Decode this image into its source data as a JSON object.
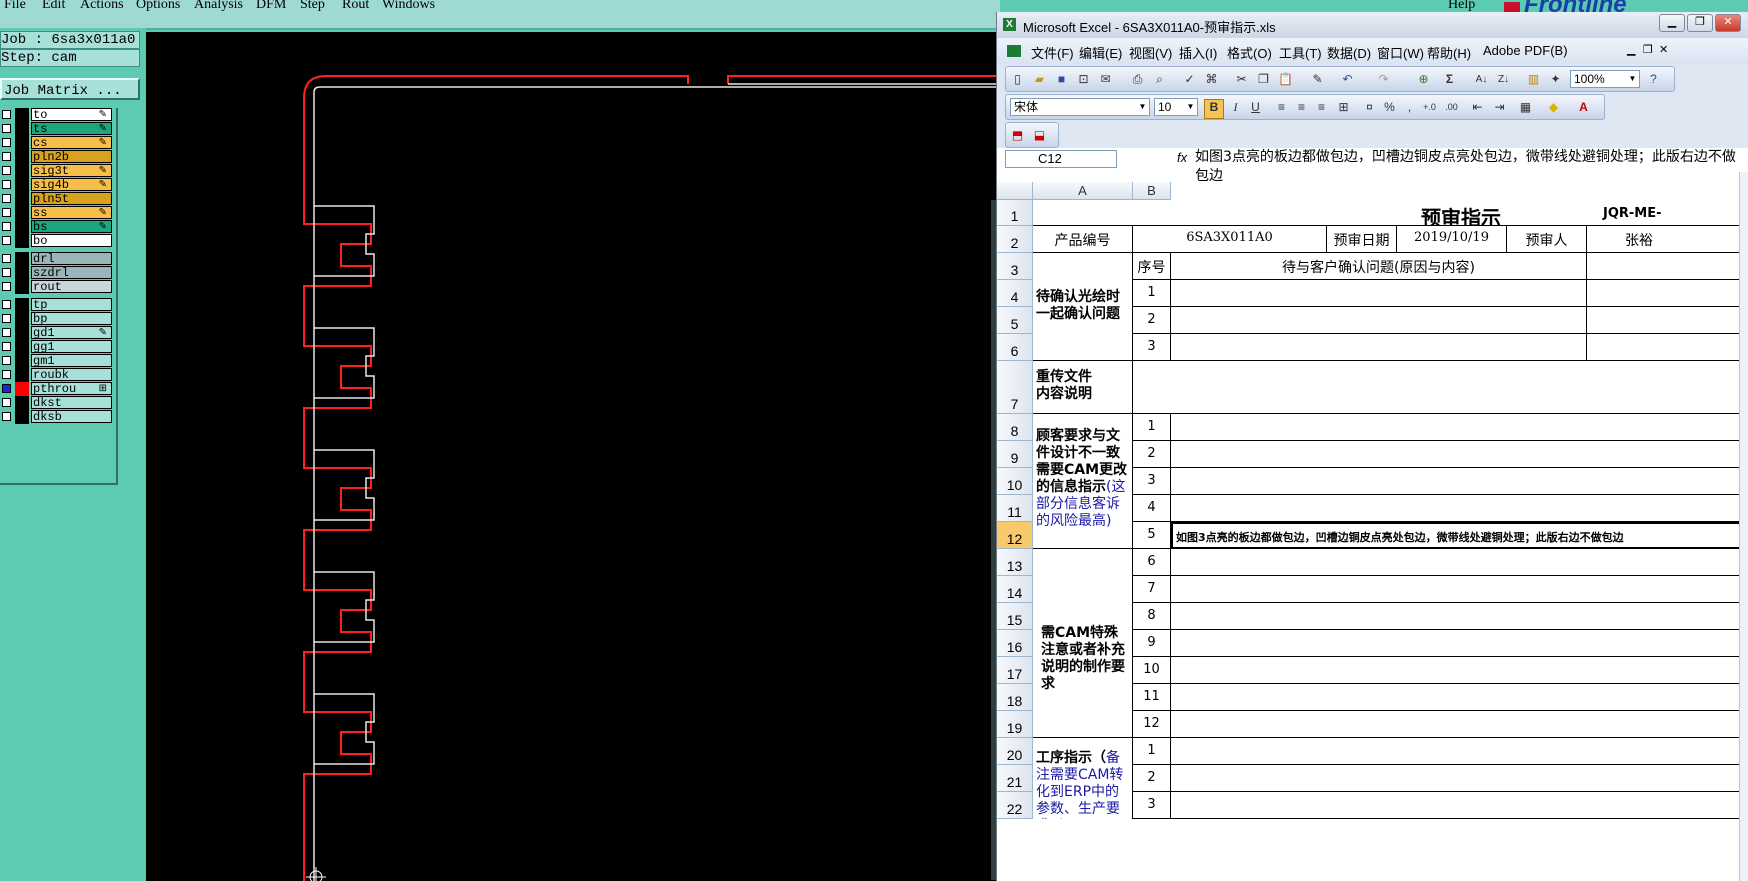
{
  "cam": {
    "menu": [
      "File",
      "Edit",
      "Actions",
      "Options",
      "Analysis",
      "DFM",
      "Step",
      "Rout",
      "Windows"
    ],
    "help": "Help",
    "logo_text": "Frontline",
    "job_line": "Job : 6sa3x011a0",
    "step_line": "Step: cam",
    "job_matrix": "Job Matrix ...",
    "layers": [
      {
        "name": "to",
        "color": "#ffffff",
        "edit": true
      },
      {
        "name": "ts",
        "color": "#1ca77f",
        "edit": true
      },
      {
        "name": "cs",
        "color": "#f7bf4a",
        "edit": true
      },
      {
        "name": "pln2b",
        "color": "#d9a21e",
        "edit": false
      },
      {
        "name": "sig3t",
        "color": "#f7bf4a",
        "edit": true
      },
      {
        "name": "sig4b",
        "color": "#f7bf4a",
        "edit": true
      },
      {
        "name": "pln5t",
        "color": "#d9a21e",
        "edit": false
      },
      {
        "name": "ss",
        "color": "#f7bf4a",
        "edit": true
      },
      {
        "name": "bs",
        "color": "#1ca77f",
        "edit": true
      },
      {
        "name": "bo",
        "color": "#ffffff",
        "edit": false
      },
      {
        "name": "drl",
        "color": "#9ab6ba",
        "edit": false
      },
      {
        "name": "szdrl",
        "color": "#9ab6ba",
        "edit": false
      },
      {
        "name": "rout",
        "color": "#c8d8da",
        "edit": false
      },
      {
        "name": "tp",
        "color": "#a6e0d8",
        "edit": false
      },
      {
        "name": "bp",
        "color": "#a6e0d8",
        "edit": false
      },
      {
        "name": "gd1",
        "color": "#a6e0d8",
        "edit": true
      },
      {
        "name": "gg1",
        "color": "#a6e0d8",
        "edit": false
      },
      {
        "name": "gm1",
        "color": "#a6e0d8",
        "edit": false
      },
      {
        "name": "roubk",
        "color": "#a6e0d8",
        "edit": false
      },
      {
        "name": "pthrou",
        "color": "#a6e0d8",
        "edit": false,
        "active": true
      },
      {
        "name": "dkst",
        "color": "#a6e0d8",
        "edit": false
      },
      {
        "name": "dksb",
        "color": "#a6e0d8",
        "edit": false
      }
    ]
  },
  "excel": {
    "title": "Microsoft Excel - 6SA3X011A0-预审指示.xls",
    "menu": [
      "文件(F)",
      "编辑(E)",
      "视图(V)",
      "插入(I)",
      "格式(O)",
      "工具(T)",
      "数据(D)",
      "窗口(W)",
      "帮助(H)",
      "Adobe PDF(B)"
    ],
    "zoom": "100%",
    "font": "宋体",
    "font_size": "10",
    "namebox": "C12",
    "fx": "fx",
    "formula": "如图3点亮的板边都做包边，凹槽边铜皮点亮处包边，微带线处避铜处理；此版右边不做包边",
    "cols": [
      "A",
      "B"
    ],
    "rows": [
      "1",
      "2",
      "3",
      "4",
      "5",
      "6",
      "7",
      "8",
      "9",
      "10",
      "11",
      "12",
      "13",
      "14",
      "15",
      "16",
      "17",
      "18",
      "19",
      "20",
      "21",
      "22"
    ],
    "sheet_title": "预审指示",
    "doc_code": "JQR-ME-",
    "product_no_label": "产品编号",
    "product_no": "6SA3X011A0",
    "review_date_label": "预审日期",
    "review_date": "2019/10/19",
    "reviewer_label": "预审人",
    "reviewer": "张裕",
    "seq_label": "序号",
    "issue_header": "待与客户确认问题(原因与内容)",
    "section1": "待确认光绘时一起确认问题",
    "section2": "重传文件内容说明",
    "section3_bold": "顾客要求与文件设计不一致需要CAM更改的信息指示",
    "section3_blue": "(这部分信息客诉的风险最高)",
    "section4": "需CAM特殊注意或者补充说明的制作要求",
    "section5_bold": "工序指示（",
    "section5_blue": "备注需要CAM转化到ERP中的参数、生产要求以",
    "c12_text": "如图3点亮的板边都做包边，凹槽边铜皮点亮处包边，微带线处避铜处理；此版右边不做包边",
    "nums1": [
      "1",
      "2",
      "3"
    ],
    "nums3": [
      "1",
      "2",
      "3",
      "4",
      "5"
    ],
    "nums4": [
      "6",
      "7",
      "8",
      "9",
      "10",
      "11",
      "12"
    ],
    "nums5": [
      "1",
      "2",
      "3"
    ]
  }
}
